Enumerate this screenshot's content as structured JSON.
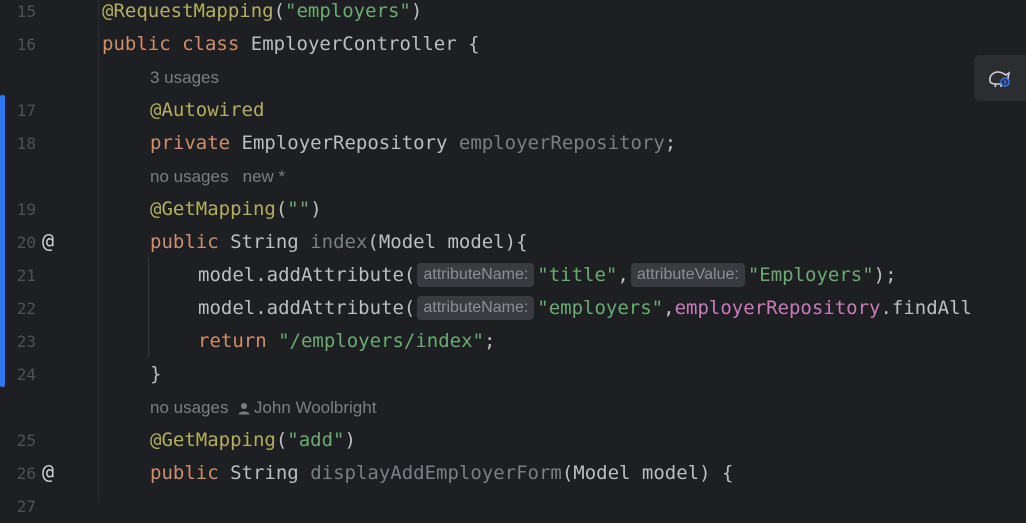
{
  "editor": {
    "line_numbers": [
      "15",
      "16",
      "17",
      "18",
      "19",
      "20",
      "21",
      "22",
      "23",
      "24",
      "25",
      "26",
      "27"
    ],
    "gutter_marker": "@",
    "lines": {
      "l15": {
        "ann": "@RequestMapping",
        "open": "(",
        "str": "\"employers\"",
        "close": ")"
      },
      "l16": {
        "kw1": "public",
        "kw2": "class",
        "name": "EmployerController",
        "brace": "{"
      },
      "l17": {
        "ann": "@Autowired"
      },
      "l18": {
        "kw": "private",
        "type": "EmployerRepository",
        "field": "employerRepository",
        "semi": ";"
      },
      "l19": {
        "ann": "@GetMapping",
        "open": "(",
        "str": "\"\"",
        "close": ")"
      },
      "l20": {
        "kw": "public",
        "type": "String",
        "method": "index",
        "params": "(Model model){"
      },
      "l21": {
        "call": "model.addAttribute(",
        "hint1": "attributeName:",
        "str1": "\"title\"",
        "comma": ",",
        "hint2": "attributeValue:",
        "str2": "\"Employers\"",
        "end": ");"
      },
      "l22": {
        "call": "model.addAttribute(",
        "hint1": "attributeName:",
        "str1": "\"employers\"",
        "comma": ",",
        "field": "employerRepository",
        "rest": ".findAll"
      },
      "l23": {
        "kw": "return",
        "str": "\"/employers/index\"",
        "semi": ";"
      },
      "l24": {
        "brace": "}"
      },
      "l25": {
        "ann": "@GetMapping",
        "open": "(",
        "str": "\"add\"",
        "close": ")"
      },
      "l26": {
        "kw": "public",
        "type": "String",
        "method": "displayAddEmployerForm",
        "params": "(Model model) {"
      }
    },
    "lens": {
      "usages_3": "3 usages",
      "no_usages_1": "no usages",
      "new_star": "new *",
      "no_usages_2": "no usages",
      "author": "John Woolbright"
    }
  },
  "colors": {
    "background": "#1e1f22",
    "keyword": "#cf8e6d",
    "annotation": "#b3ae60",
    "string": "#6aab73",
    "field": "#c77dbb",
    "vcs_modified": "#3574f0"
  },
  "icons": {
    "ai_assistant": "ai-assistant-icon",
    "author": "person-icon"
  }
}
